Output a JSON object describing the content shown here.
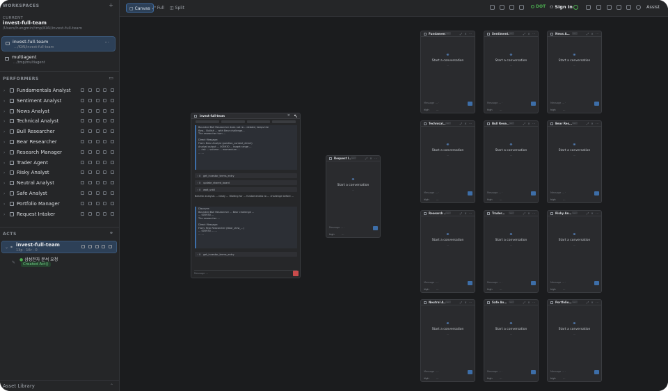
{
  "sidebar": {
    "workspaces_title": "WORKSPACES",
    "current_label": "CURRENT",
    "current_name": "invest-full-team",
    "current_path": "/Users/hungmin/tmp/KIAI/invest-full-team",
    "workspaces": [
      {
        "name": "invest-full-team",
        "path": "…/KIAI/invest-full-team",
        "active": true
      },
      {
        "name": "multiagent",
        "path": "…/tmp/multiagent",
        "active": false
      }
    ],
    "performers_title": "PERFORMERS",
    "performers": [
      "Fundamentals Analyst",
      "Sentiment Analyst",
      "News Analyst",
      "Technical Analyst",
      "Bull Researcher",
      "Bear Researcher",
      "Research Manager",
      "Trader Agent",
      "Risky Analyst",
      "Neutral Analyst",
      "Safe Analyst",
      "Portfolio Manager",
      "Request Intaker"
    ],
    "acts_title": "ACTS",
    "act": {
      "name": "invest-full-team",
      "meta": "13p · 16r · 0"
    },
    "sub_act": {
      "label": "삼성전자 분석 요청",
      "badge": "Created Act()"
    },
    "asset_library": "Asset Library"
  },
  "toolbar": {
    "tabs": [
      {
        "label": "Canvas",
        "icon": "▢",
        "active": true
      },
      {
        "label": "Full",
        "icon": "⤢",
        "active": false
      },
      {
        "label": "Split",
        "icon": "◫",
        "active": false
      }
    ],
    "dot_label": "DOT",
    "signin_label": "Sign In",
    "user_label": "Assist"
  },
  "chat": {
    "title": "invest-full-team",
    "messages": [
      {
        "type": "block",
        "text": "Bounded Bull Researcher does not re... debate; keeps the\nflow... Bullish ... with Bear challenge...\nThe researcher turn ...\n\nDirect Message:\nFrom: Bear Analyst (position_context_direct)\nAnalyst output ... 005930 ... target range ...\n... risk ... volume ... momentum ...\n... ..."
      },
      {
        "type": "tool",
        "name": "get_investor_terms_entry"
      },
      {
        "type": "tool",
        "name": "update_shared_board"
      },
      {
        "type": "tool",
        "name": "wait_until"
      },
      {
        "type": "plain",
        "text": "Bearish analysis ... ready ... Waiting for ... fundamentals to ...\nchallenge before ..."
      },
      {
        "type": "block",
        "text": "Discover:\nBounded Bull Researcher ... Bear challenge ...\n... 005930 ...\nThe researcher ...\n\nDirect Message:\nFrom: Risk Researcher (Bear_view_...)\n... 005930 ... ...\n... ..."
      },
      {
        "type": "tool",
        "name": "get_investor_terms_entry"
      }
    ],
    "input_placeholder": "Message ..."
  },
  "cards": [
    {
      "title": "Fundament…"
    },
    {
      "title": "Sentiment…"
    },
    {
      "title": "News A…"
    },
    {
      "title": "Technical…"
    },
    {
      "title": "Bull Rese…"
    },
    {
      "title": "Bear Res…"
    },
    {
      "title": "Research …"
    },
    {
      "title": "Trader…"
    },
    {
      "title": "Risky An…"
    },
    {
      "title": "Neutral A…"
    },
    {
      "title": "Safe An…"
    },
    {
      "title": "Portfolio…"
    },
    {
      "title": "Request I…"
    }
  ],
  "card_common": {
    "badge": "…",
    "start": "Start a conversation",
    "sub": "…",
    "input": "Message … ·",
    "foot": "high",
    "foot2": "…"
  }
}
